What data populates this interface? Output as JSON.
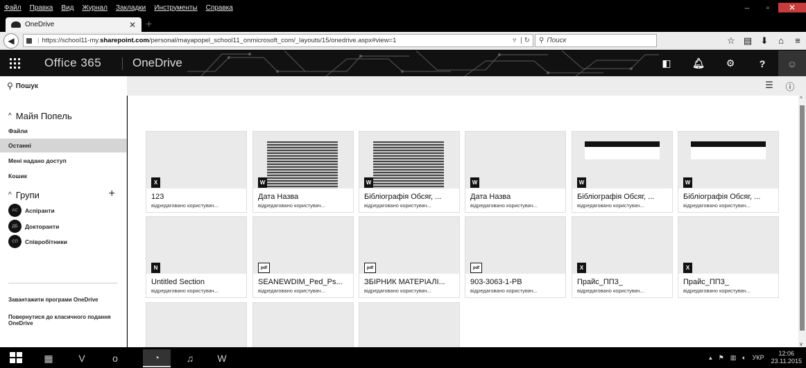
{
  "browser": {
    "menu": [
      "Файл",
      "Правка",
      "Вид",
      "Журнал",
      "Закладки",
      "Инструменты",
      "Справка"
    ],
    "tab_title": "OneDrive",
    "url_prefix": "https://school11-my.",
    "url_domain": "sharepoint.com",
    "url_path": "/personal/mayapopel_school11_onmicrosoft_com/_layouts/15/onedrive.aspx#view=1",
    "search_placeholder": "Поиск"
  },
  "suitebar": {
    "suite_name": "Office 365",
    "app_name": "OneDrive"
  },
  "commandbar": {
    "search_label": "Пошук"
  },
  "leftnav": {
    "user_group": "Майя Попель",
    "items": [
      {
        "label": "Файли",
        "selected": false
      },
      {
        "label": "Останні",
        "selected": true
      },
      {
        "label": "Мені надано доступ",
        "selected": false
      },
      {
        "label": "Кошик",
        "selected": false
      }
    ],
    "groups_label": "Групи",
    "groups": [
      {
        "initials": "АС",
        "label": "Аспіранти"
      },
      {
        "initials": "ДБ",
        "label": "Докторанти"
      },
      {
        "initials": "СП",
        "label": "Співробітники"
      }
    ],
    "get_apps": "Завантажити програми OneDrive",
    "classic": "Повернутися до класичного подання OneDrive"
  },
  "files": [
    {
      "name": "123",
      "sub": "відредаговано користувач...",
      "type": "x",
      "preview": "none"
    },
    {
      "name": "Дата Назва",
      "sub": "відредаговано користувач...",
      "type": "w",
      "preview": "doc"
    },
    {
      "name": "Бібліографія Обсяг, ...",
      "sub": "відредаговано користувач...",
      "type": "w",
      "preview": "doc"
    },
    {
      "name": "Дата Назва",
      "sub": "відредаговано користувач...",
      "type": "w",
      "preview": "none"
    },
    {
      "name": "Бібліографія Обсяг, ...",
      "sub": "відредаговано користувач...",
      "type": "w",
      "preview": "sheet"
    },
    {
      "name": "Бібліографія Обсяг, ...",
      "sub": "відредаговано користувач...",
      "type": "w",
      "preview": "sheet"
    },
    {
      "name": "Untitled Section",
      "sub": "відредаговано користувач...",
      "type": "n",
      "preview": "none"
    },
    {
      "name": "SEANEWDIM_Ped_Ps...",
      "sub": "відредаговано користувач...",
      "type": "pdf",
      "preview": "none"
    },
    {
      "name": "ЗБІРНИК МАТЕРІАЛІ...",
      "sub": "відредаговано користувач...",
      "type": "pdf",
      "preview": "none"
    },
    {
      "name": "903-3063-1-PB",
      "sub": "відредаговано користувач...",
      "type": "pdf",
      "preview": "none"
    },
    {
      "name": "Прайс_ПП3_",
      "sub": "відредаговано користувач...",
      "type": "x",
      "preview": "none"
    },
    {
      "name": "Прайс_ПП3_",
      "sub": "відредаговано користувач...",
      "type": "x",
      "preview": "none"
    },
    {
      "name": "",
      "sub": "",
      "type": "pdf",
      "preview": "none"
    },
    {
      "name": "",
      "sub": "",
      "type": "pdf",
      "preview": "none"
    },
    {
      "name": "",
      "sub": "",
      "type": "pdf",
      "preview": "none"
    }
  ],
  "taskbar": {
    "lang": "УКР",
    "time": "12:06",
    "date": "23.11.2015"
  }
}
